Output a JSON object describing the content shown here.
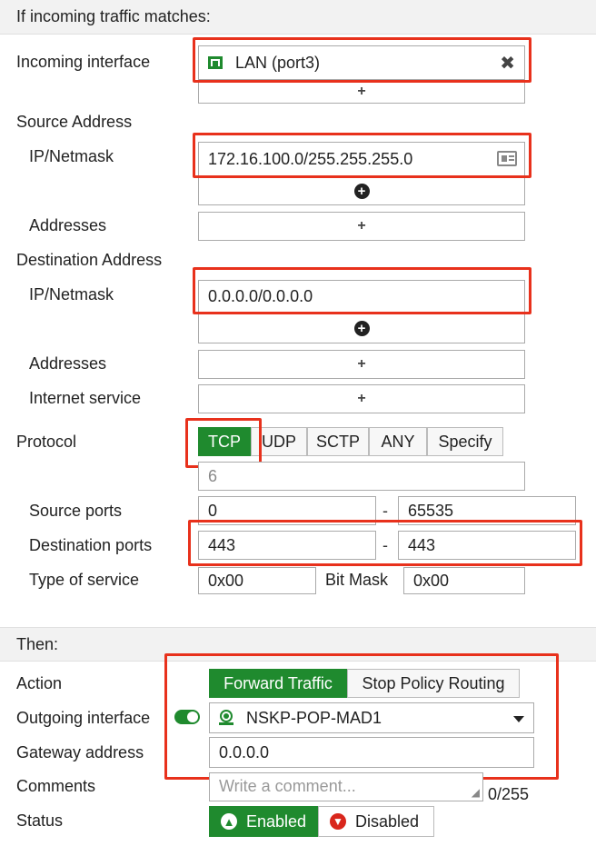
{
  "match_section": {
    "title": "If incoming traffic matches:",
    "incoming_interface": {
      "label": "Incoming interface",
      "value": "LAN (port3)",
      "icon": "network-port-icon",
      "remove_icon": "close-icon",
      "add": "+"
    },
    "source_address": {
      "heading": "Source Address",
      "ipnetmask_label": "IP/Netmask",
      "ipnetmask_value": "172.16.100.0/255.255.255.0",
      "card_icon": "address-card-icon",
      "addresses_label": "Addresses",
      "add": "+"
    },
    "destination_address": {
      "heading": "Destination Address",
      "ipnetmask_label": "IP/Netmask",
      "ipnetmask_value": "0.0.0.0/0.0.0.0",
      "addresses_label": "Addresses",
      "internet_service_label": "Internet service",
      "add": "+"
    },
    "protocol": {
      "label": "Protocol",
      "options": [
        "TCP",
        "UDP",
        "SCTP",
        "ANY",
        "Specify"
      ],
      "selected": "TCP",
      "number": "6"
    },
    "source_ports": {
      "label": "Source ports",
      "from": "0",
      "separator": "-",
      "to": "65535"
    },
    "destination_ports": {
      "label": "Destination ports",
      "from": "443",
      "separator": "-",
      "to": "443"
    },
    "type_of_service": {
      "label": "Type of service",
      "value": "0x00",
      "bitmask_label": "Bit Mask",
      "bitmask_value": "0x00"
    }
  },
  "then_section": {
    "title": "Then:",
    "action": {
      "label": "Action",
      "options": [
        "Forward Traffic",
        "Stop Policy Routing"
      ],
      "selected": "Forward Traffic"
    },
    "outgoing_interface": {
      "label": "Outgoing interface",
      "value": "NSKP-POP-MAD1",
      "toggle": "on"
    },
    "gateway_address": {
      "label": "Gateway address",
      "value": "0.0.0.0"
    },
    "comments": {
      "label": "Comments",
      "placeholder": "Write a comment...",
      "counter": "0/255"
    },
    "status": {
      "label": "Status",
      "enabled": "Enabled",
      "disabled": "Disabled",
      "selected": "Enabled"
    }
  },
  "colors": {
    "highlight": "#e8311c",
    "active": "#1f8a2e",
    "border": "#aaaaaa",
    "header_bg": "#f2f2f2"
  }
}
